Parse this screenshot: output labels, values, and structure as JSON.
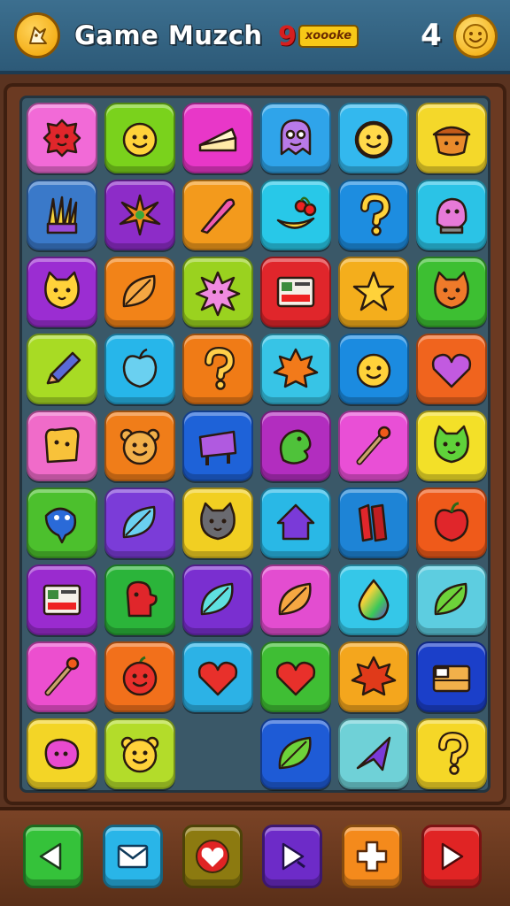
{
  "header": {
    "title": "Game Muzch",
    "logo_letter": "9",
    "logo_text": "xoooke",
    "level": "4",
    "menu_icon": "star-chick-icon",
    "coin_icon": "smiley-coin-icon"
  },
  "board": {
    "rows": [
      [
        {
          "icon": "red-blob-face",
          "color": "#f26ad7"
        },
        {
          "icon": "yellow-smiley",
          "color": "#7ad21c"
        },
        {
          "icon": "cake-slice",
          "color": "#e837c8"
        },
        {
          "icon": "purple-ghost",
          "color": "#2fa4ea"
        },
        {
          "icon": "yellow-flower-face",
          "color": "#33b8ee"
        },
        {
          "icon": "acorn-pot",
          "color": "#f4d82a"
        }
      ],
      [
        {
          "icon": "book-fan",
          "color": "#3a79c9"
        },
        {
          "icon": "orange-star-burst",
          "color": "#8d2cc8"
        },
        {
          "icon": "pink-carrot",
          "color": "#f39a1c"
        },
        {
          "icon": "banana-cherries",
          "color": "#28c8e8"
        },
        {
          "icon": "question-mark",
          "color": "#1d8de0"
        },
        {
          "icon": "pink-bird",
          "color": "#2bc3e6"
        }
      ],
      [
        {
          "icon": "yellow-cat",
          "color": "#9b2dd2"
        },
        {
          "icon": "orange-leaf",
          "color": "#f28318"
        },
        {
          "icon": "pink-sun",
          "color": "#9ad21f"
        },
        {
          "icon": "window-panel",
          "color": "#e0262b"
        },
        {
          "icon": "yellow-star",
          "color": "#f4ae1c"
        },
        {
          "icon": "orange-cat",
          "color": "#3dbf32"
        }
      ],
      [
        {
          "icon": "pencil",
          "color": "#a8db24"
        },
        {
          "icon": "blue-apple",
          "color": "#27b6ea"
        },
        {
          "icon": "question-swirl",
          "color": "#f07b16"
        },
        {
          "icon": "maple-leaf",
          "color": "#37c4e6"
        },
        {
          "icon": "yellow-smiley",
          "color": "#1b8be0"
        },
        {
          "icon": "purple-heart",
          "color": "#f0641e"
        }
      ],
      [
        {
          "icon": "toast",
          "color": "#f06bc9"
        },
        {
          "icon": "bear-face",
          "color": "#f07d19"
        },
        {
          "icon": "signboard",
          "color": "#1e62d8"
        },
        {
          "icon": "green-dragon",
          "color": "#b22dbf"
        },
        {
          "icon": "wand",
          "color": "#e94fd6"
        },
        {
          "icon": "green-cat",
          "color": "#f3e028"
        }
      ],
      [
        {
          "icon": "blue-fish",
          "color": "#4cc02d"
        },
        {
          "icon": "blue-leaf",
          "color": "#7b3cd8"
        },
        {
          "icon": "gray-cat",
          "color": "#f1cf22"
        },
        {
          "icon": "purple-house",
          "color": "#29b8e6"
        },
        {
          "icon": "red-book",
          "color": "#1e84d6"
        },
        {
          "icon": "red-apple",
          "color": "#ef5a1a"
        }
      ],
      [
        {
          "icon": "window-panel",
          "color": "#9a2bcf"
        },
        {
          "icon": "red-mitten",
          "color": "#2bb43a"
        },
        {
          "icon": "teal-leaf",
          "color": "#7a2fd0"
        },
        {
          "icon": "orange-leaf",
          "color": "#e34dd0"
        },
        {
          "icon": "rainbow-drop",
          "color": "#35c7e8"
        },
        {
          "icon": "green-leaf",
          "color": "#5dcde0"
        }
      ],
      [
        {
          "icon": "wand",
          "color": "#ec4fcf"
        },
        {
          "icon": "red-apple-face",
          "color": "#f2701b"
        },
        {
          "icon": "red-heart",
          "color": "#2cb2e6"
        },
        {
          "icon": "red-heart",
          "color": "#3fbe34"
        },
        {
          "icon": "red-maple-leaf",
          "color": "#f4a61d"
        },
        {
          "icon": "treasure-box",
          "color": "#1b3fc9"
        }
      ],
      [
        {
          "icon": "pink-bean",
          "color": "#f3d526"
        },
        {
          "icon": "yellow-bear",
          "color": "#b3dc2a"
        },
        null,
        {
          "icon": "green-leaf",
          "color": "#1e5bd6"
        },
        {
          "icon": "purple-arrow",
          "color": "#6fd1d7"
        },
        {
          "icon": "question-mark",
          "color": "#f5d727"
        }
      ]
    ]
  },
  "footer": {
    "buttons": [
      {
        "name": "back",
        "icon": "left-arrow-icon",
        "color": "#35c23a"
      },
      {
        "name": "mail",
        "icon": "mail-icon",
        "color": "#29b5e8"
      },
      {
        "name": "heart",
        "icon": "heart-icon",
        "color": "#8c7a10"
      },
      {
        "name": "play-cursor",
        "icon": "play-cursor-icon",
        "color": "#6d2bc8"
      },
      {
        "name": "plus",
        "icon": "plus-icon",
        "color": "#f48a1c"
      },
      {
        "name": "next",
        "icon": "right-arrow-icon",
        "color": "#e02424"
      }
    ]
  }
}
